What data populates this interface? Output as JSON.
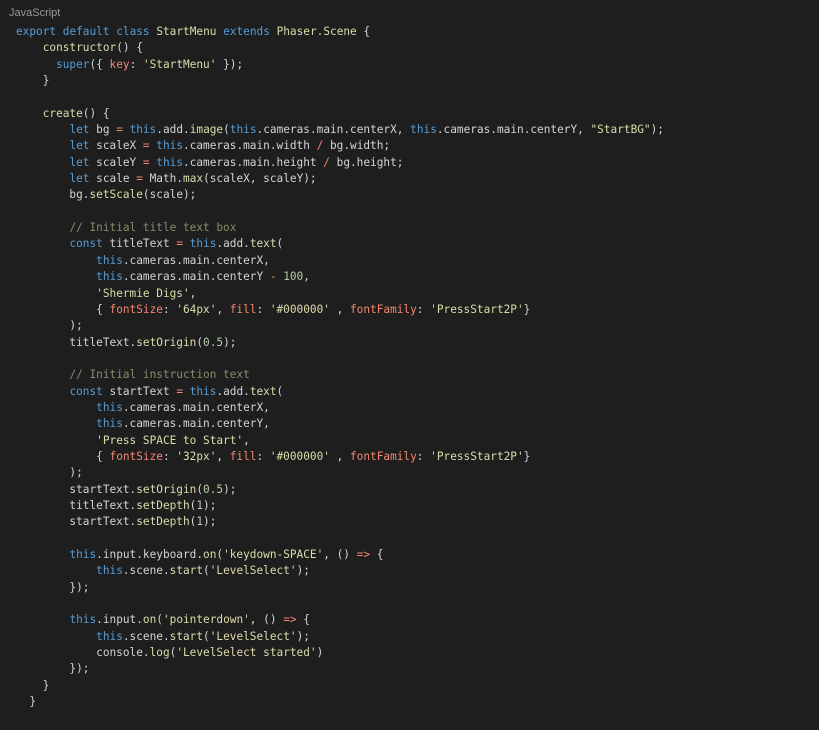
{
  "language_label": "JavaScript",
  "code_lines": [
    [
      {
        "t": "export",
        "c": "kw"
      },
      {
        "t": " "
      },
      {
        "t": "default",
        "c": "kw"
      },
      {
        "t": " "
      },
      {
        "t": "class",
        "c": "kw"
      },
      {
        "t": " "
      },
      {
        "t": "StartMenu",
        "c": "cls"
      },
      {
        "t": " "
      },
      {
        "t": "extends",
        "c": "kw"
      },
      {
        "t": " "
      },
      {
        "t": "Phaser",
        "c": "cls"
      },
      {
        "t": "."
      },
      {
        "t": "Scene",
        "c": "cls"
      },
      {
        "t": " {"
      }
    ],
    [
      {
        "t": "    "
      },
      {
        "t": "constructor",
        "c": "fn"
      },
      {
        "t": "() {"
      }
    ],
    [
      {
        "t": "      "
      },
      {
        "t": "super",
        "c": "kw"
      },
      {
        "t": "({ "
      },
      {
        "t": "key",
        "c": "prop"
      },
      {
        "t": ": "
      },
      {
        "t": "'StartMenu'",
        "c": "str"
      },
      {
        "t": " });"
      }
    ],
    [
      {
        "t": "    }"
      }
    ],
    [
      {
        "t": ""
      }
    ],
    [
      {
        "t": "    "
      },
      {
        "t": "create",
        "c": "fn"
      },
      {
        "t": "() {"
      }
    ],
    [
      {
        "t": "        "
      },
      {
        "t": "let",
        "c": "kw"
      },
      {
        "t": " bg "
      },
      {
        "t": "=",
        "c": "op"
      },
      {
        "t": " "
      },
      {
        "t": "this",
        "c": "this"
      },
      {
        "t": "."
      },
      {
        "t": "add",
        "c": "var"
      },
      {
        "t": "."
      },
      {
        "t": "image",
        "c": "fn"
      },
      {
        "t": "("
      },
      {
        "t": "this",
        "c": "this"
      },
      {
        "t": ".cameras.main.centerX, "
      },
      {
        "t": "this",
        "c": "this"
      },
      {
        "t": ".cameras.main.centerY, "
      },
      {
        "t": "\"StartBG\"",
        "c": "str"
      },
      {
        "t": ");"
      }
    ],
    [
      {
        "t": "        "
      },
      {
        "t": "let",
        "c": "kw"
      },
      {
        "t": " scaleX "
      },
      {
        "t": "=",
        "c": "op"
      },
      {
        "t": " "
      },
      {
        "t": "this",
        "c": "this"
      },
      {
        "t": ".cameras.main.width "
      },
      {
        "t": "/",
        "c": "op"
      },
      {
        "t": " bg.width;"
      }
    ],
    [
      {
        "t": "        "
      },
      {
        "t": "let",
        "c": "kw"
      },
      {
        "t": " scaleY "
      },
      {
        "t": "=",
        "c": "op"
      },
      {
        "t": " "
      },
      {
        "t": "this",
        "c": "this"
      },
      {
        "t": ".cameras.main.height "
      },
      {
        "t": "/",
        "c": "op"
      },
      {
        "t": " bg.height;"
      }
    ],
    [
      {
        "t": "        "
      },
      {
        "t": "let",
        "c": "kw"
      },
      {
        "t": " scale "
      },
      {
        "t": "=",
        "c": "op"
      },
      {
        "t": " Math."
      },
      {
        "t": "max",
        "c": "fn"
      },
      {
        "t": "(scaleX, scaleY);"
      }
    ],
    [
      {
        "t": "        bg."
      },
      {
        "t": "setScale",
        "c": "fn"
      },
      {
        "t": "(scale);"
      }
    ],
    [
      {
        "t": ""
      }
    ],
    [
      {
        "t": "        "
      },
      {
        "t": "// Initial title text box",
        "c": "cmt"
      }
    ],
    [
      {
        "t": "        "
      },
      {
        "t": "const",
        "c": "kw"
      },
      {
        "t": " titleText "
      },
      {
        "t": "=",
        "c": "op"
      },
      {
        "t": " "
      },
      {
        "t": "this",
        "c": "this"
      },
      {
        "t": ".add."
      },
      {
        "t": "text",
        "c": "fn"
      },
      {
        "t": "("
      }
    ],
    [
      {
        "t": "            "
      },
      {
        "t": "this",
        "c": "this"
      },
      {
        "t": ".cameras.main.centerX,"
      }
    ],
    [
      {
        "t": "            "
      },
      {
        "t": "this",
        "c": "this"
      },
      {
        "t": ".cameras.main.centerY "
      },
      {
        "t": "-",
        "c": "op"
      },
      {
        "t": " "
      },
      {
        "t": "100",
        "c": "num"
      },
      {
        "t": ","
      }
    ],
    [
      {
        "t": "            "
      },
      {
        "t": "'Shermie Digs'",
        "c": "str"
      },
      {
        "t": ","
      }
    ],
    [
      {
        "t": "            { "
      },
      {
        "t": "fontSize",
        "c": "prop"
      },
      {
        "t": ": "
      },
      {
        "t": "'64px'",
        "c": "str"
      },
      {
        "t": ", "
      },
      {
        "t": "fill",
        "c": "prop"
      },
      {
        "t": ": "
      },
      {
        "t": "'#000000'",
        "c": "str"
      },
      {
        "t": " , "
      },
      {
        "t": "fontFamily",
        "c": "prop"
      },
      {
        "t": ": "
      },
      {
        "t": "'PressStart2P'",
        "c": "str"
      },
      {
        "t": "}"
      }
    ],
    [
      {
        "t": "        );"
      }
    ],
    [
      {
        "t": "        titleText."
      },
      {
        "t": "setOrigin",
        "c": "fn"
      },
      {
        "t": "("
      },
      {
        "t": "0.5",
        "c": "num"
      },
      {
        "t": ");"
      }
    ],
    [
      {
        "t": ""
      }
    ],
    [
      {
        "t": "        "
      },
      {
        "t": "// Initial instruction text",
        "c": "cmt"
      }
    ],
    [
      {
        "t": "        "
      },
      {
        "t": "const",
        "c": "kw"
      },
      {
        "t": " startText "
      },
      {
        "t": "=",
        "c": "op"
      },
      {
        "t": " "
      },
      {
        "t": "this",
        "c": "this"
      },
      {
        "t": ".add."
      },
      {
        "t": "text",
        "c": "fn"
      },
      {
        "t": "("
      }
    ],
    [
      {
        "t": "            "
      },
      {
        "t": "this",
        "c": "this"
      },
      {
        "t": ".cameras.main.centerX,"
      }
    ],
    [
      {
        "t": "            "
      },
      {
        "t": "this",
        "c": "this"
      },
      {
        "t": ".cameras.main.centerY,"
      }
    ],
    [
      {
        "t": "            "
      },
      {
        "t": "'Press SPACE to Start'",
        "c": "str"
      },
      {
        "t": ","
      }
    ],
    [
      {
        "t": "            { "
      },
      {
        "t": "fontSize",
        "c": "prop"
      },
      {
        "t": ": "
      },
      {
        "t": "'32px'",
        "c": "str"
      },
      {
        "t": ", "
      },
      {
        "t": "fill",
        "c": "prop"
      },
      {
        "t": ": "
      },
      {
        "t": "'#000000'",
        "c": "str"
      },
      {
        "t": " , "
      },
      {
        "t": "fontFamily",
        "c": "prop"
      },
      {
        "t": ": "
      },
      {
        "t": "'PressStart2P'",
        "c": "str"
      },
      {
        "t": "}"
      }
    ],
    [
      {
        "t": "        );"
      }
    ],
    [
      {
        "t": "        startText."
      },
      {
        "t": "setOrigin",
        "c": "fn"
      },
      {
        "t": "("
      },
      {
        "t": "0.5",
        "c": "num"
      },
      {
        "t": ");"
      }
    ],
    [
      {
        "t": "        titleText."
      },
      {
        "t": "setDepth",
        "c": "fn"
      },
      {
        "t": "("
      },
      {
        "t": "1",
        "c": "num"
      },
      {
        "t": ");"
      }
    ],
    [
      {
        "t": "        startText."
      },
      {
        "t": "setDepth",
        "c": "fn"
      },
      {
        "t": "("
      },
      {
        "t": "1",
        "c": "num"
      },
      {
        "t": ");"
      }
    ],
    [
      {
        "t": ""
      }
    ],
    [
      {
        "t": "        "
      },
      {
        "t": "this",
        "c": "this"
      },
      {
        "t": ".input.keyboard."
      },
      {
        "t": "on",
        "c": "fn"
      },
      {
        "t": "("
      },
      {
        "t": "'keydown-SPACE'",
        "c": "str"
      },
      {
        "t": ", () "
      },
      {
        "t": "=>",
        "c": "op"
      },
      {
        "t": " {"
      }
    ],
    [
      {
        "t": "            "
      },
      {
        "t": "this",
        "c": "this"
      },
      {
        "t": ".scene."
      },
      {
        "t": "start",
        "c": "fn"
      },
      {
        "t": "("
      },
      {
        "t": "'LevelSelect'",
        "c": "str"
      },
      {
        "t": ");"
      }
    ],
    [
      {
        "t": "        });"
      }
    ],
    [
      {
        "t": ""
      }
    ],
    [
      {
        "t": "        "
      },
      {
        "t": "this",
        "c": "this"
      },
      {
        "t": ".input."
      },
      {
        "t": "on",
        "c": "fn"
      },
      {
        "t": "("
      },
      {
        "t": "'pointerdown'",
        "c": "str"
      },
      {
        "t": ", () "
      },
      {
        "t": "=>",
        "c": "op"
      },
      {
        "t": " {"
      }
    ],
    [
      {
        "t": "            "
      },
      {
        "t": "this",
        "c": "this"
      },
      {
        "t": ".scene."
      },
      {
        "t": "start",
        "c": "fn"
      },
      {
        "t": "("
      },
      {
        "t": "'LevelSelect'",
        "c": "str"
      },
      {
        "t": ");"
      }
    ],
    [
      {
        "t": "            console."
      },
      {
        "t": "log",
        "c": "fn"
      },
      {
        "t": "("
      },
      {
        "t": "'LevelSelect started'",
        "c": "str"
      },
      {
        "t": ")"
      }
    ],
    [
      {
        "t": "        });"
      }
    ],
    [
      {
        "t": "    }"
      }
    ],
    [
      {
        "t": "  }"
      }
    ]
  ]
}
